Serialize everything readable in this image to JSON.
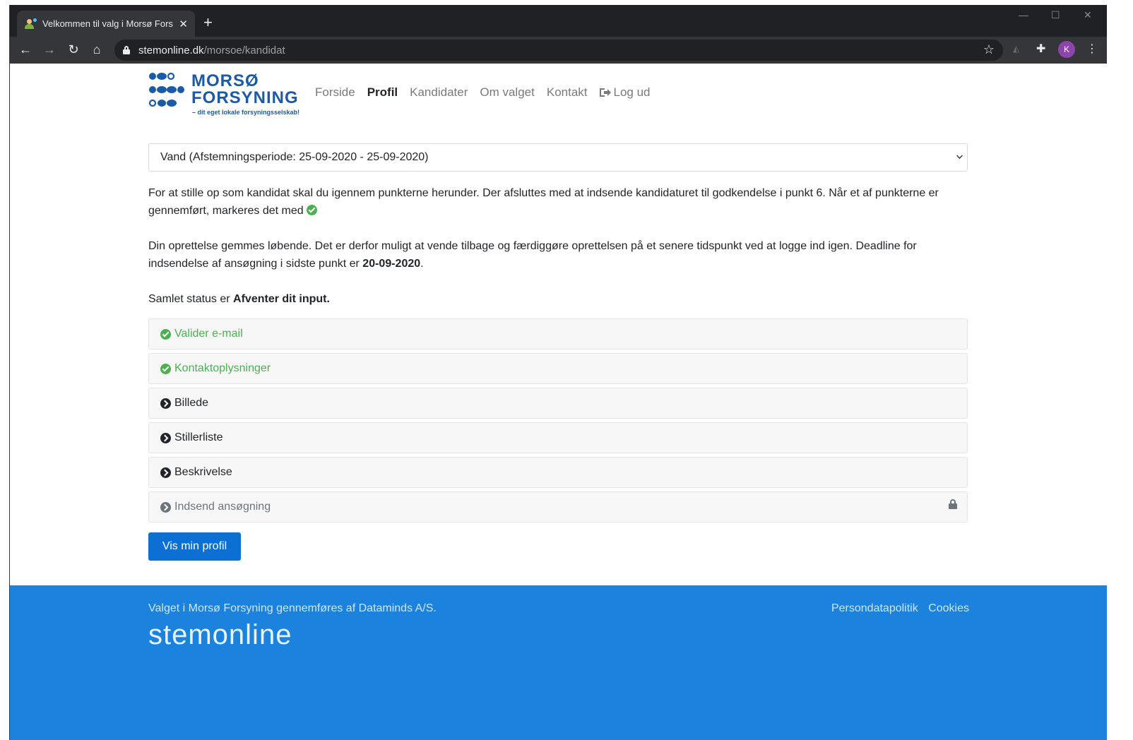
{
  "browser": {
    "tab_title": "Velkommen til valg i Morsø Forsy",
    "tab_close": "✕",
    "new_tab": "+",
    "url_host": "stemonline.dk",
    "url_path": "/morsoe/kandidat",
    "avatar_letter": "K"
  },
  "logo": {
    "line1": "MORSØ",
    "line2": "FORSYNING",
    "tagline": "– dit eget lokale forsyningsselskab!"
  },
  "nav": {
    "items": [
      {
        "label": "Forside",
        "active": false
      },
      {
        "label": "Profil",
        "active": true
      },
      {
        "label": "Kandidater",
        "active": false
      },
      {
        "label": "Om valget",
        "active": false
      },
      {
        "label": "Kontakt",
        "active": false
      }
    ],
    "logout": "Log ud"
  },
  "period_select": {
    "selected": "Vand (Afstemningsperiode: 25-09-2020 - 25-09-2020)"
  },
  "intro": {
    "p1": "For at stille op som kandidat skal du igennem punkterne herunder. Der afsluttes med at indsende kandidaturet til godkendelse i punkt 6. Når et af punkterne er gennemført, markeres det med",
    "p2_before": "Din oprettelse gemmes løbende. Det er derfor muligt at vende tilbage og færdiggøre oprettelsen på et senere tidspunkt ved at logge ind igen. Deadline for indsendelse af ansøgning i sidste punkt er ",
    "p2_deadline": "20-09-2020",
    "p2_after": ".",
    "status_prefix": "Samlet status er ",
    "status_value": "Afventer dit input."
  },
  "steps": [
    {
      "label": "Valider e-mail",
      "state": "done"
    },
    {
      "label": "Kontaktoplysninger",
      "state": "done"
    },
    {
      "label": "Billede",
      "state": "todo"
    },
    {
      "label": "Stillerliste",
      "state": "todo"
    },
    {
      "label": "Beskrivelse",
      "state": "todo"
    },
    {
      "label": "Indsend ansøgning",
      "state": "locked"
    }
  ],
  "profile_button": "Vis min profil",
  "footer": {
    "text": "Valget i Morsø Forsyning gennemføres af Dataminds A/S.",
    "brand": "stemonline",
    "links": [
      "Persondatapolitik",
      "Cookies"
    ]
  },
  "colors": {
    "primary": "#0b6fd3",
    "footer": "#1b82dd",
    "done": "#4caf50",
    "logo": "#1c5aa6"
  }
}
